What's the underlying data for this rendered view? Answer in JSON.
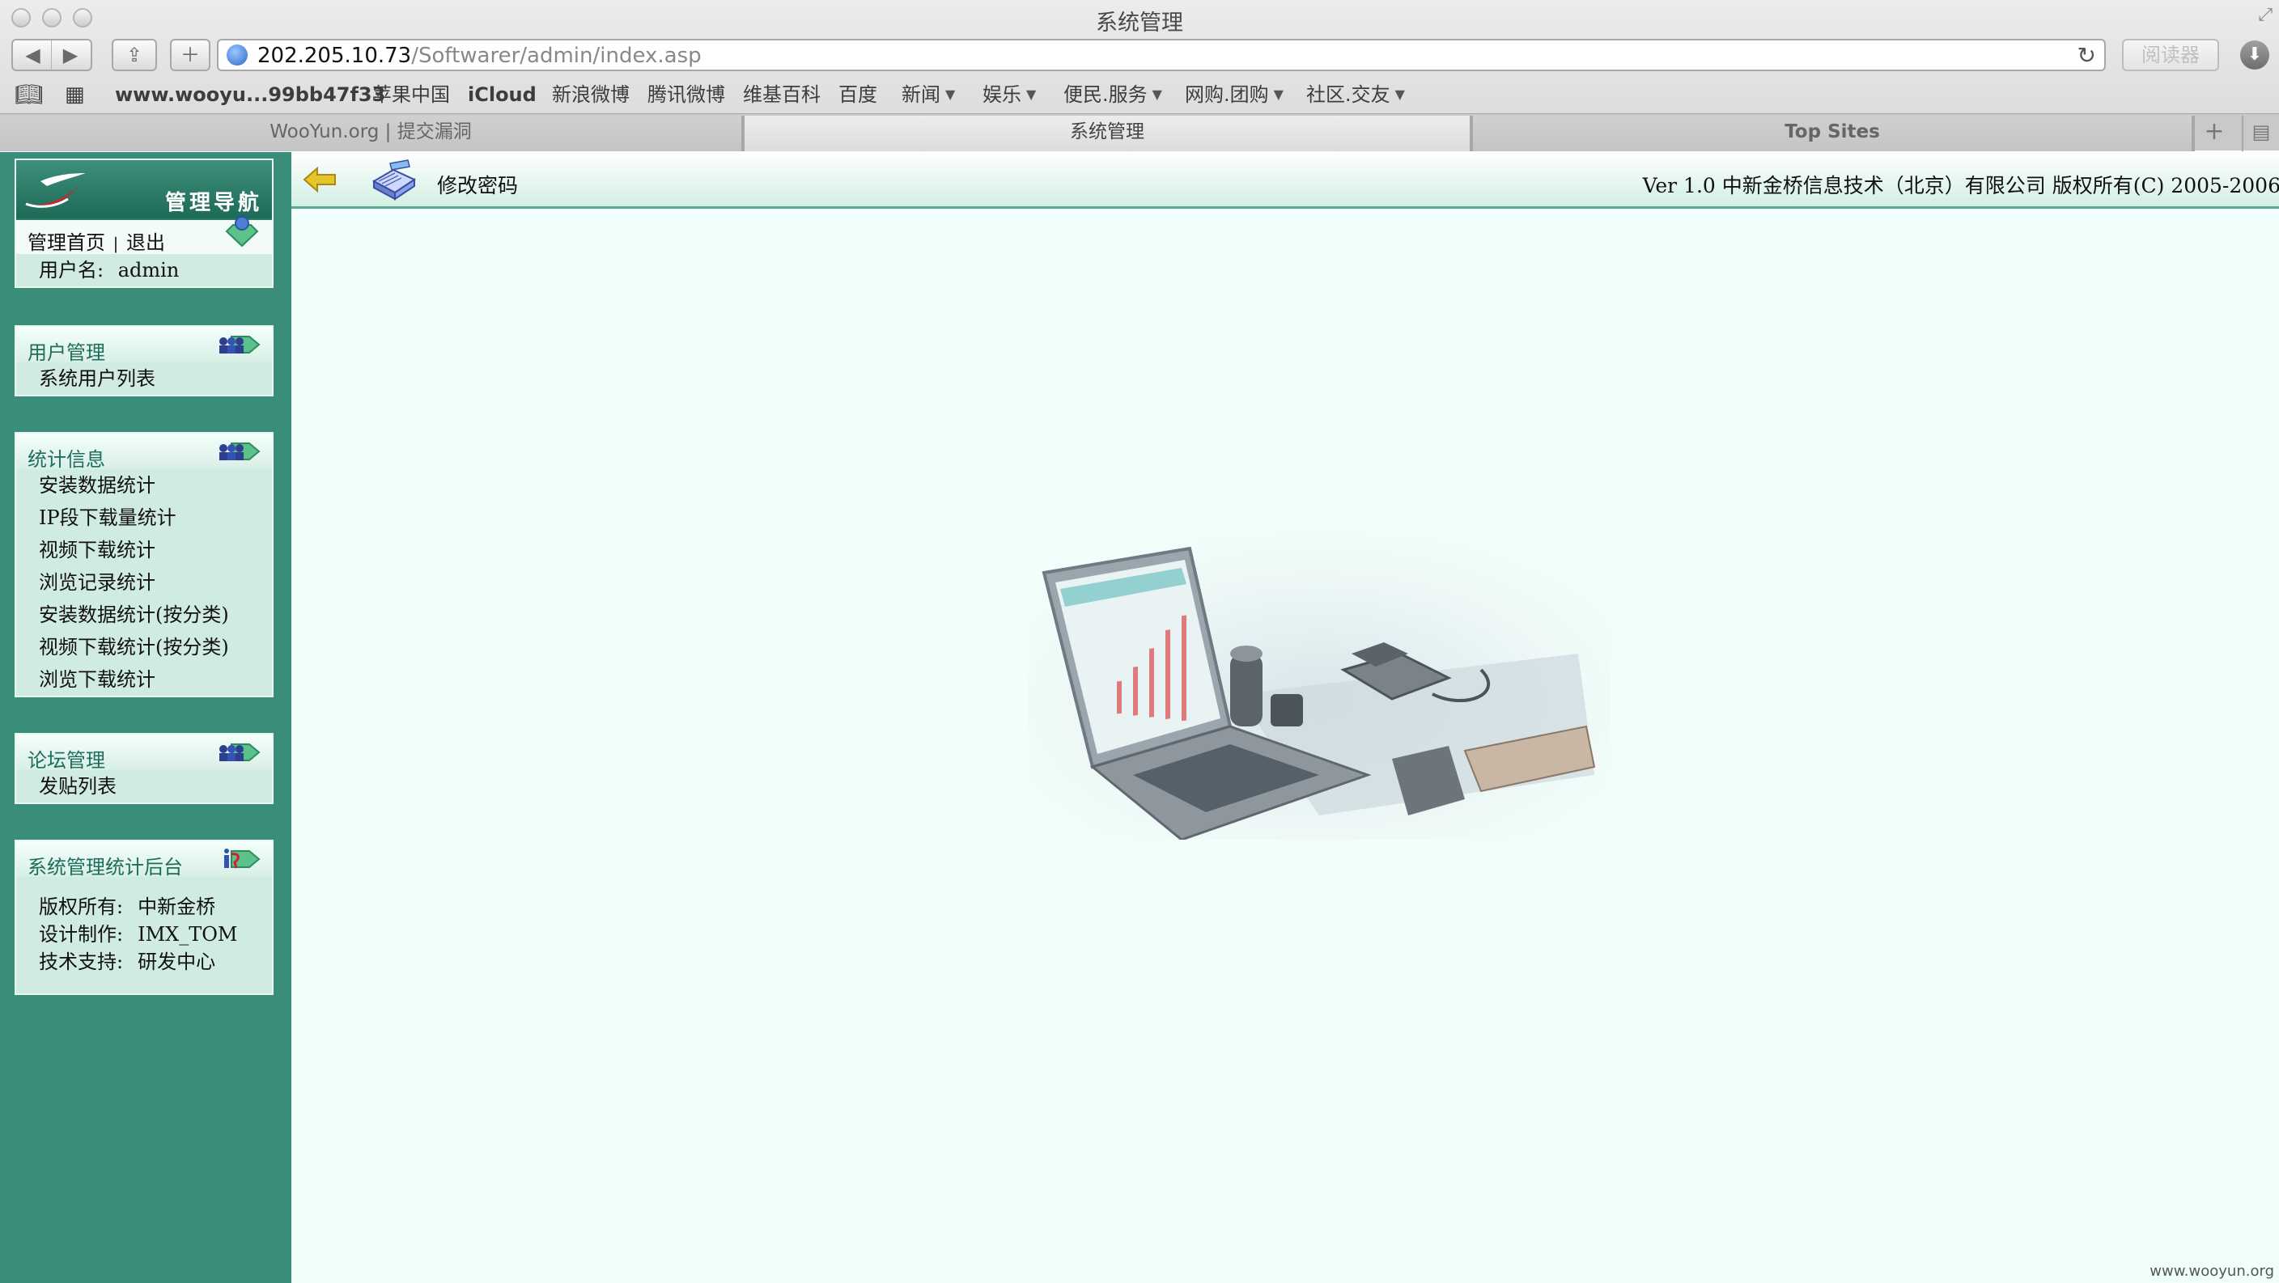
{
  "window": {
    "title": "系统管理"
  },
  "toolbar": {
    "url_host": "202.205.10.73",
    "url_path": "/Softwarer/admin/index.asp",
    "reader_label": "阅读器"
  },
  "bookmarks": [
    {
      "label": "www.wooyu...99bb47f33",
      "bold": true
    },
    {
      "label": "苹果中国"
    },
    {
      "label": "iCloud",
      "bold": true
    },
    {
      "label": "新浪微博"
    },
    {
      "label": "腾讯微博"
    },
    {
      "label": "维基百科"
    },
    {
      "label": "百度"
    },
    {
      "label": "新闻",
      "menu": true
    },
    {
      "label": "娱乐",
      "menu": true
    },
    {
      "label": "便民.服务",
      "menu": true
    },
    {
      "label": "网购.团购",
      "menu": true
    },
    {
      "label": "社区.交友",
      "menu": true
    }
  ],
  "tabs": [
    {
      "label": "WooYun.org | 提交漏洞"
    },
    {
      "label": "系统管理",
      "active": true
    },
    {
      "label": "Top Sites"
    }
  ],
  "sidebar": {
    "nav_title": "管理导航",
    "home_link": "管理首页",
    "separator": "|",
    "logout_link": "退出",
    "username_label": "用户名:",
    "username_value": "admin",
    "sections": {
      "user_mgmt": {
        "title": "用户管理",
        "items": [
          "系统用户列表"
        ]
      },
      "stats": {
        "title": "统计信息",
        "items": [
          "安装数据统计",
          "IP段下载量统计",
          "视频下载统计",
          "浏览记录统计",
          "安装数据统计(按分类)",
          "视频下载统计(按分类)",
          "浏览下载统计"
        ]
      },
      "forum": {
        "title": "论坛管理",
        "items": [
          "发贴列表"
        ]
      },
      "system": {
        "title": "系统管理统计后台",
        "credits": [
          {
            "label": "版权所有:",
            "value": "中新金桥"
          },
          {
            "label": "设计制作:",
            "value": "IMX_TOM"
          },
          {
            "label": "技术支持:",
            "value": "研发中心"
          }
        ]
      }
    }
  },
  "content": {
    "change_password": "修改密码",
    "copyright": "Ver 1.0 中新金桥信息技术（北京）有限公司 版权所有(C) 2005-2006"
  },
  "watermark": "www.wooyun.org",
  "colors": {
    "sidebar_bg": "#3a8d78",
    "panel_bg": "#d0ebe2",
    "content_bg": "#f0fffb",
    "section_title": "#1f6d5c"
  }
}
